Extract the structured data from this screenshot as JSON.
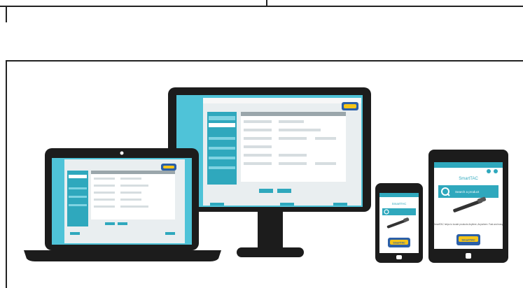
{
  "tablet": {
    "app_title": "SmartTAC",
    "search_label": "Search a product",
    "body_text": "SmartTAC helps to locate products Anytime, Anywhere. Fast and easy.",
    "logo_text": "SmartTAC"
  },
  "phone": {
    "app_title": "SmartTAC",
    "logo_text": "SmartTAC"
  },
  "colors": {
    "teal": "#2fa8bd",
    "screen_bg": "#e9eef0",
    "device": "#1c1c1c",
    "accent": "#4fc3d8"
  }
}
